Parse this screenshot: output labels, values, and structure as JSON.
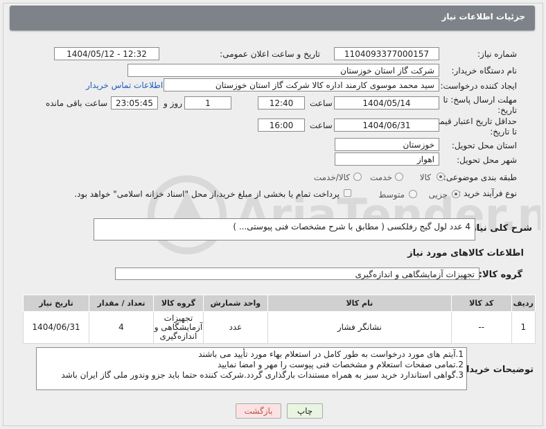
{
  "title": "جزئیات اطلاعات نیاز",
  "fields": {
    "need_number_label": "شماره نیاز:",
    "need_number": "1104093377000157",
    "announce_label": "تاریخ و ساعت اعلان عمومی:",
    "announce_value": "1404/05/12 - 12:32",
    "buyer_org_label": "نام دستگاه خریدار:",
    "buyer_org": "شرکت گاز استان خوزستان",
    "creator_label": "ایجاد کننده درخواست:",
    "creator": "سید محمد موسوی کارمند اداره کالا شرکت گاز استان خوزستان",
    "contact_link": "اطلاعات تماس خریدار",
    "deadline_label": "مهلت ارسال پاسخ: تا تاریخ:",
    "deadline_date": "1404/05/14",
    "time_label": "ساعت",
    "deadline_time": "12:40",
    "days_value": "1",
    "days_label": "روز و",
    "remaining_time": "23:05:45",
    "remaining_label": "ساعت باقی مانده",
    "validity_label": "حداقل تاریخ اعتبار قیمت: تا تاریخ:",
    "validity_date": "1404/06/31",
    "validity_time": "16:00",
    "province_label": "استان محل تحویل:",
    "province": "خوزستان",
    "city_label": "شهر محل تحویل:",
    "city": "اهواز",
    "category_label": "طبقه بندی موضوعی:",
    "category_options": [
      "کالا",
      "خدمت",
      "کالا/خدمت"
    ],
    "process_label": "نوع فرآیند خرید :",
    "process_options": [
      "جزیی",
      "متوسط"
    ],
    "payment_note": "پرداخت تمام یا بخشی از مبلغ خرید،از محل \"اسناد خزانه اسلامی\" خواهد بود.",
    "summary_label": "شرح کلی نیاز:",
    "summary": "4 عدد لول گیج رفلکسی ( مطابق با شرح مشخصات فنی پیوستی... )",
    "goods_info_title": "اطلاعات کالاهای مورد نیاز",
    "goods_group_label": "گروه کالا:",
    "goods_group": "تجهیزات آزمایشگاهی و اندازه‌گیری"
  },
  "table": {
    "headers": [
      "ردیف",
      "کد کالا",
      "نام کالا",
      "واحد شمارش",
      "گروه کالا",
      "تعداد / مقدار",
      "تاریخ نیاز"
    ],
    "row": [
      "1",
      "--",
      "نشانگر فشار",
      "عدد",
      "تجهیزات آزمایشگاهی و اندازه‌گیری",
      "4",
      "1404/06/31"
    ]
  },
  "notes_label": "توضیحات خریدار:",
  "notes": [
    "1.آیتم های مورد درخواست به طور کامل در استعلام بهاء مورد تأیید می باشند",
    "2.تمامی صفحات استعلام و مشخصات فنی پیوست را مهر و امضا نمایید",
    "3.گواهی استاندارد خرید سبز به همراه مستندات بارگذاری گردد.شرکت کننده حتما باید جزو وندور ملی گاز ایران باشد"
  ],
  "buttons": {
    "print": "چاپ",
    "back": "بازگشت"
  },
  "watermark": "AriaTender.neT",
  "colors": {
    "title_bg": "#7d8388",
    "link": "#1f5fbf",
    "print_bg": "#e8f5e0",
    "back_bg": "#fbe3e3",
    "back_text": "#c0504d"
  }
}
